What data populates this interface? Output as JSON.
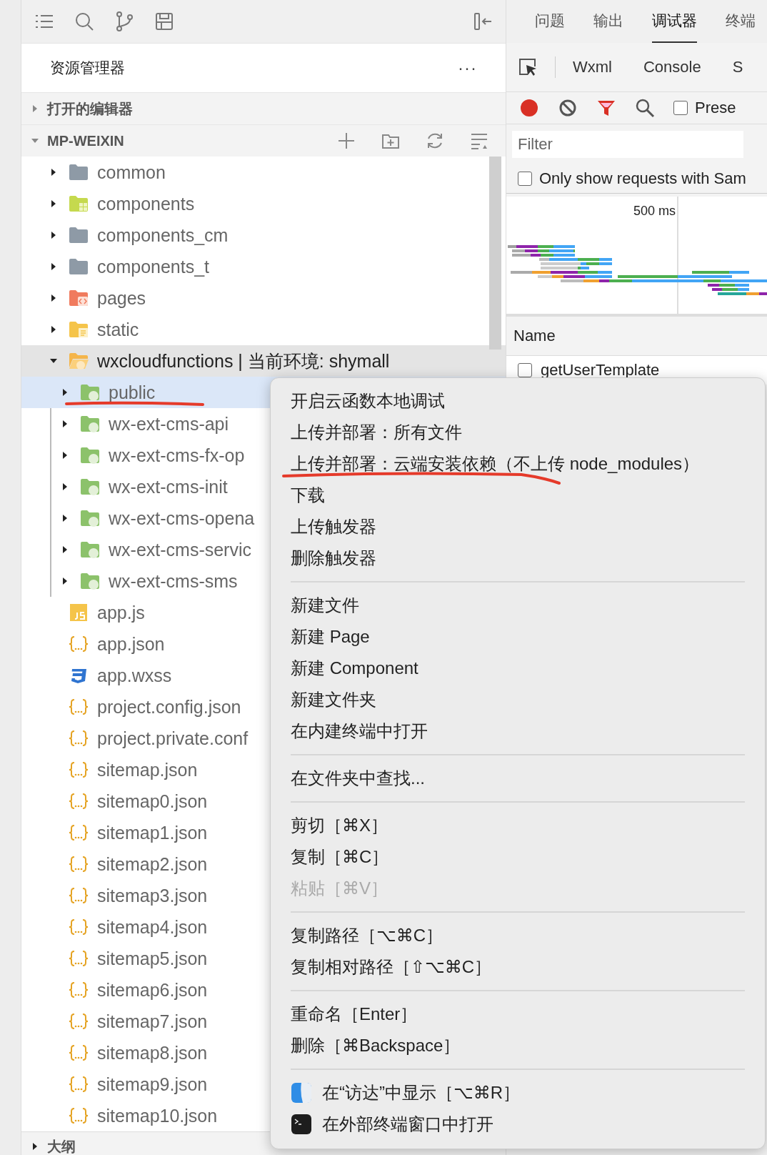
{
  "panel_tabs": [
    {
      "label": "问题",
      "selected": false
    },
    {
      "label": "输出",
      "selected": false
    },
    {
      "label": "调试器",
      "selected": true
    },
    {
      "label": "终端",
      "selected": false
    }
  ],
  "explorer": {
    "title": "资源管理器",
    "more": "···",
    "sections": [
      {
        "label": "打开的编辑器",
        "expanded": false
      },
      {
        "label": "MP-WEIXIN",
        "expanded": true
      }
    ],
    "bottom_section": {
      "label": "大纲",
      "expanded": false
    }
  },
  "tree": [
    {
      "label": "common",
      "kind": "folder",
      "expanded": false,
      "selected": false
    },
    {
      "label": "components",
      "kind": "folder-components",
      "expanded": false,
      "selected": false
    },
    {
      "label": "components_cm",
      "kind": "folder",
      "expanded": false,
      "selected": false
    },
    {
      "label": "components_t",
      "kind": "folder",
      "expanded": false,
      "selected": false
    },
    {
      "label": "pages",
      "kind": "folder-pages",
      "expanded": false,
      "selected": false
    },
    {
      "label": "static",
      "kind": "folder-static",
      "expanded": false,
      "selected": false
    },
    {
      "label": "wxcloudfunctions | 当前环境: shymall",
      "kind": "folder-cloud-root",
      "expanded": true,
      "selected": false,
      "children": [
        {
          "label": "public",
          "kind": "folder-cloud",
          "expanded": false,
          "selected": true
        },
        {
          "label": "wx-ext-cms-api",
          "kind": "folder-cloud",
          "expanded": false,
          "selected": false
        },
        {
          "label": "wx-ext-cms-fx-op",
          "kind": "folder-cloud",
          "expanded": false,
          "selected": false
        },
        {
          "label": "wx-ext-cms-init",
          "kind": "folder-cloud",
          "expanded": false,
          "selected": false
        },
        {
          "label": "wx-ext-cms-opena",
          "kind": "folder-cloud",
          "expanded": false,
          "selected": false
        },
        {
          "label": "wx-ext-cms-servic",
          "kind": "folder-cloud",
          "expanded": false,
          "selected": false
        },
        {
          "label": "wx-ext-cms-sms",
          "kind": "folder-cloud",
          "expanded": false,
          "selected": false
        }
      ]
    },
    {
      "label": "app.js",
      "kind": "js",
      "selected": false
    },
    {
      "label": "app.json",
      "kind": "json",
      "selected": false
    },
    {
      "label": "app.wxss",
      "kind": "css",
      "selected": false
    },
    {
      "label": "project.config.json",
      "kind": "json",
      "selected": false
    },
    {
      "label": "project.private.conf",
      "kind": "json",
      "selected": false
    },
    {
      "label": "sitemap.json",
      "kind": "json",
      "selected": false
    },
    {
      "label": "sitemap0.json",
      "kind": "json",
      "selected": false
    },
    {
      "label": "sitemap1.json",
      "kind": "json",
      "selected": false
    },
    {
      "label": "sitemap2.json",
      "kind": "json",
      "selected": false
    },
    {
      "label": "sitemap3.json",
      "kind": "json",
      "selected": false
    },
    {
      "label": "sitemap4.json",
      "kind": "json",
      "selected": false
    },
    {
      "label": "sitemap5.json",
      "kind": "json",
      "selected": false
    },
    {
      "label": "sitemap6.json",
      "kind": "json",
      "selected": false
    },
    {
      "label": "sitemap7.json",
      "kind": "json",
      "selected": false
    },
    {
      "label": "sitemap8.json",
      "kind": "json",
      "selected": false
    },
    {
      "label": "sitemap9.json",
      "kind": "json",
      "selected": false
    },
    {
      "label": "sitemap10.json",
      "kind": "json",
      "selected": false
    }
  ],
  "devtools": {
    "tabs": [
      "Wxml",
      "Console",
      "S"
    ],
    "preserve": {
      "label": "Prese",
      "checked": false
    },
    "filter": {
      "placeholder": "Filter"
    },
    "same_site": {
      "label": "Only show requests with Sam",
      "checked": false
    },
    "timeline_label": "500 ms",
    "name_column": "Name",
    "rows": [
      {
        "name": "getUserTemplate"
      }
    ]
  },
  "context_menu": [
    [
      {
        "label": "开启云函数本地调试",
        "disabled": false
      },
      {
        "label": "上传并部署：所有文件",
        "disabled": false
      },
      {
        "label": "上传并部署：云端安装依赖（不上传 node_modules）",
        "disabled": false
      },
      {
        "label": "下载",
        "disabled": false
      },
      {
        "label": "上传触发器",
        "disabled": false
      },
      {
        "label": "删除触发器",
        "disabled": false
      }
    ],
    [
      {
        "label": "新建文件",
        "disabled": false
      },
      {
        "label": "新建 Page",
        "disabled": false
      },
      {
        "label": "新建 Component",
        "disabled": false
      },
      {
        "label": "新建文件夹",
        "disabled": false
      },
      {
        "label": "在内建终端中打开",
        "disabled": false
      }
    ],
    [
      {
        "label": "在文件夹中查找...",
        "disabled": false
      }
    ],
    [
      {
        "label": "剪切［⌘X］",
        "disabled": false
      },
      {
        "label": "复制［⌘C］",
        "disabled": false
      },
      {
        "label": "粘贴［⌘V］",
        "disabled": true
      }
    ],
    [
      {
        "label": "复制路径［⌥⌘C］",
        "disabled": false
      },
      {
        "label": "复制相对路径［⇧⌥⌘C］",
        "disabled": false
      }
    ],
    [
      {
        "label": "重命名［Enter］",
        "disabled": false
      },
      {
        "label": "删除［⌘Backspace］",
        "disabled": false
      }
    ],
    [
      {
        "label": "在“访达”中显示［⌥⌘R］",
        "disabled": false,
        "kind": "finder"
      },
      {
        "label": "在外部终端窗口中打开",
        "disabled": false,
        "kind": "terminal"
      }
    ]
  ]
}
